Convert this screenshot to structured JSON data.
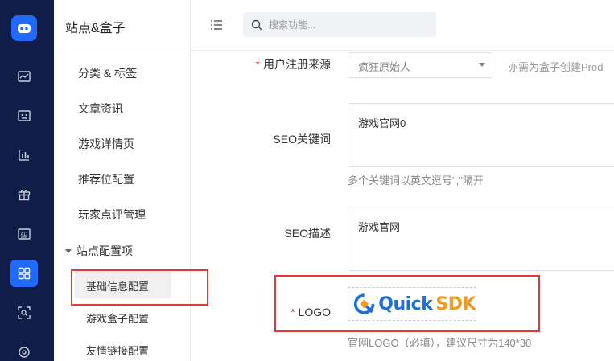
{
  "colors": {
    "rail_bg": "#0f1d48",
    "accent": "#1f6bff",
    "required": "#e53935",
    "highlight_frame": "#e53935"
  },
  "rail": {
    "logo_icon": "robot-face-icon",
    "items": [
      "dashboard-chart-icon",
      "media-card-icon",
      "bar-chart-icon",
      "gift-icon",
      "ad-icon",
      "grid-apps-icon",
      "scan-icon",
      "settings-icon"
    ],
    "active_index": 5
  },
  "sidebar": {
    "title": "站点&盒子",
    "items": [
      {
        "label": "分类 & 标签"
      },
      {
        "label": "文章资讯"
      },
      {
        "label": "游戏详情页"
      },
      {
        "label": "推荐位配置"
      },
      {
        "label": "玩家点评管理"
      }
    ],
    "group": {
      "label": "站点配置项",
      "children": [
        {
          "label": "基础信息配置",
          "active": true
        },
        {
          "label": "游戏盒子配置"
        },
        {
          "label": "友情链接配置"
        }
      ]
    }
  },
  "topbar": {
    "search_placeholder": "搜索功能..."
  },
  "form": {
    "register_source": {
      "label": "用户注册来源",
      "value": "疯狂原始人",
      "tip": "亦需为盒子创建Prod"
    },
    "seo_keywords": {
      "label": "SEO关键词",
      "value": "游戏官网0",
      "hint": "多个关键词以英文逗号\",\"隔开"
    },
    "seo_description": {
      "label": "SEO描述",
      "value": "游戏官网"
    },
    "logo": {
      "label": "LOGO",
      "brand_a": "Quick",
      "brand_b": "SDK",
      "hint": "官网LOGO（必填），建议尺寸为140*30"
    }
  }
}
